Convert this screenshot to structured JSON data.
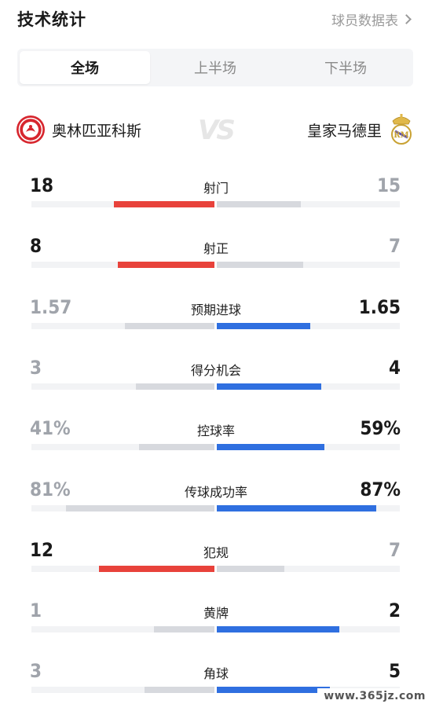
{
  "header": {
    "title": "技术统计",
    "link_label": "球员数据表"
  },
  "tabs": [
    {
      "label": "全场",
      "active": true
    },
    {
      "label": "上半场",
      "active": false
    },
    {
      "label": "下半场",
      "active": false
    }
  ],
  "teams": {
    "home": {
      "name": "奥林匹亚科斯",
      "crest": "olympiacos-crest-icon"
    },
    "vs_label": "VS",
    "away": {
      "name": "皇家马德里",
      "crest": "real-madrid-crest-icon"
    }
  },
  "colors": {
    "leader_home": "#e8423b",
    "leader_away": "#2f6fe0",
    "trailing": "#d7d9de",
    "track": "#f2f3f5",
    "winner_text": "#1a1a1a",
    "loser_text": "#a0a4ab"
  },
  "stats": [
    {
      "label": "射门",
      "home": "18",
      "away": "15",
      "home_share": 0.55,
      "away_share": 0.46,
      "leader": "home"
    },
    {
      "label": "射正",
      "home": "8",
      "away": "7",
      "home_share": 0.53,
      "away_share": 0.47,
      "leader": "home"
    },
    {
      "label": "预期进球",
      "home": "1.57",
      "away": "1.65",
      "home_share": 0.49,
      "away_share": 0.51,
      "leader": "away"
    },
    {
      "label": "得分机会",
      "home": "3",
      "away": "4",
      "home_share": 0.43,
      "away_share": 0.57,
      "leader": "away"
    },
    {
      "label": "控球率",
      "home": "41%",
      "away": "59%",
      "home_share": 0.41,
      "away_share": 0.59,
      "leader": "away"
    },
    {
      "label": "传球成功率",
      "home": "81%",
      "away": "87%",
      "home_share": 0.81,
      "away_share": 0.87,
      "leader": "away"
    },
    {
      "label": "犯规",
      "home": "12",
      "away": "7",
      "home_share": 0.63,
      "away_share": 0.37,
      "leader": "home"
    },
    {
      "label": "黄牌",
      "home": "1",
      "away": "2",
      "home_share": 0.33,
      "away_share": 0.67,
      "leader": "away"
    },
    {
      "label": "角球",
      "home": "3",
      "away": "5",
      "home_share": 0.38,
      "away_share": 0.62,
      "leader": "away"
    }
  ],
  "watermark": "www.365jz.com"
}
